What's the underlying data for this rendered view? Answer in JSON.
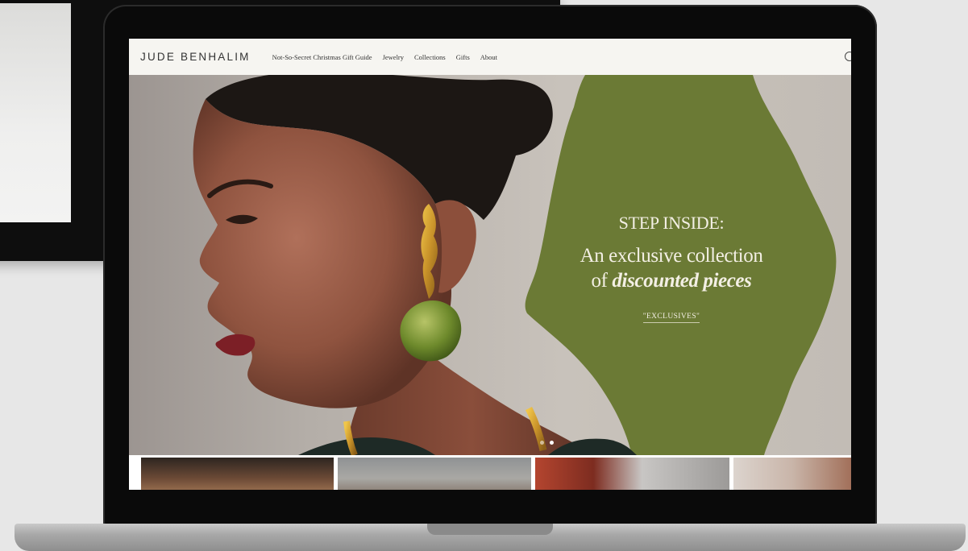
{
  "site": {
    "brand": "JUDE BENHALIM",
    "nav_items": [
      "Not-So-Secret Christmas Gift Guide",
      "Jewelry",
      "Collections",
      "Gifts",
      "About"
    ]
  },
  "hero": {
    "eyebrow": "STEP INSIDE:",
    "headline_line1": "An exclusive collection",
    "headline_line2_prefix": "of ",
    "headline_line2_emphasis": "discounted pieces",
    "cta_label": "\"EXCLUSIVES\"",
    "slide_count": 2,
    "active_slide": 2
  },
  "icons": {
    "search": "search-icon"
  },
  "colors": {
    "accent_green": "#6b7a35",
    "hero_text": "#f3efe4",
    "nav_background": "#f6f5f1"
  }
}
